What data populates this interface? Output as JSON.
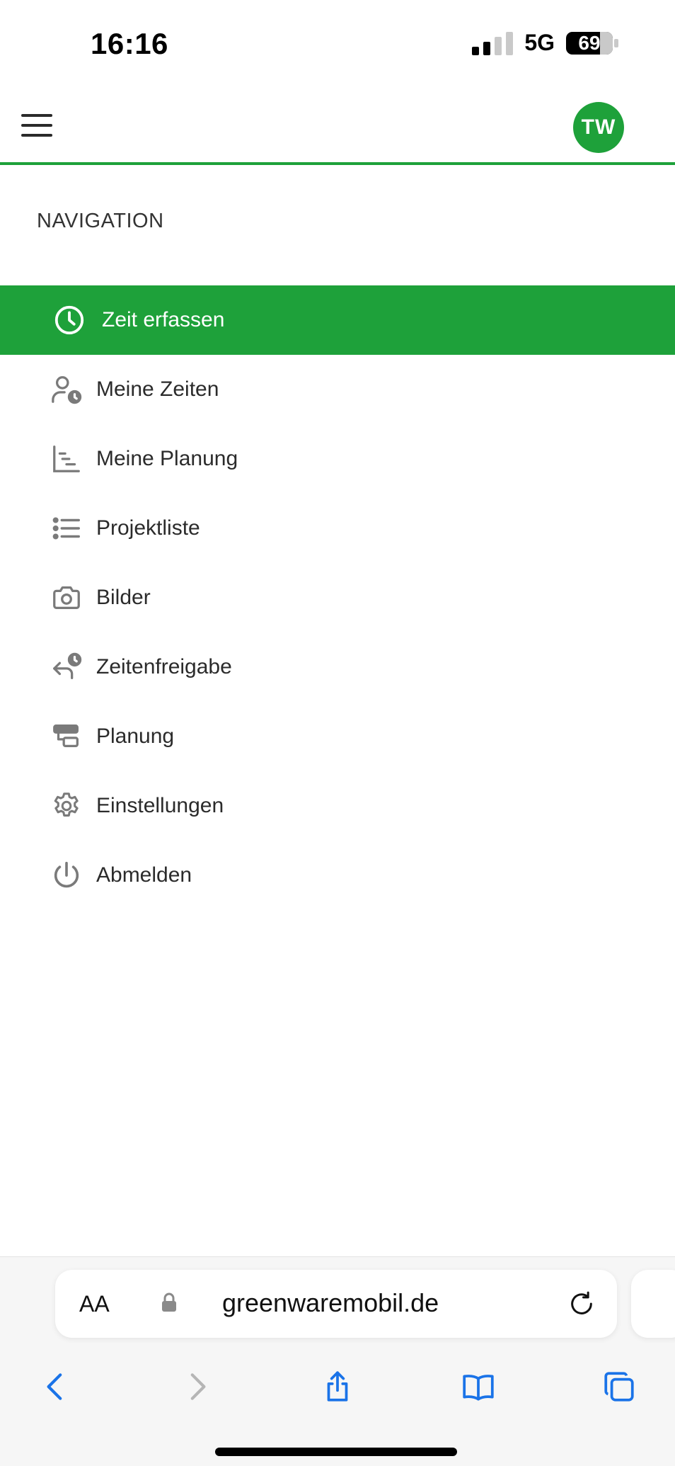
{
  "status_bar": {
    "time": "16:16",
    "network": "5G",
    "battery": "69"
  },
  "header": {
    "avatar_initials": "TW"
  },
  "navigation": {
    "title": "NAVIGATION",
    "items": [
      {
        "label": "Zeit erfassen",
        "icon": "clock-icon",
        "active": true
      },
      {
        "label": "Meine Zeiten",
        "icon": "user-clock-icon"
      },
      {
        "label": "Meine Planung",
        "icon": "gantt-chart-icon"
      },
      {
        "label": "Projektliste",
        "icon": "list-icon"
      },
      {
        "label": "Bilder",
        "icon": "camera-icon"
      },
      {
        "label": "Zeitenfreigabe",
        "icon": "time-approval-icon"
      },
      {
        "label": "Planung",
        "icon": "planning-icon"
      },
      {
        "label": "Einstellungen",
        "icon": "gear-icon"
      },
      {
        "label": "Abmelden",
        "icon": "power-icon"
      }
    ]
  },
  "browser": {
    "text_size_label": "AA",
    "url": "greenwaremobil.de"
  },
  "colors": {
    "accent": "#1ea13a",
    "safari_blue": "#1a73e8"
  }
}
